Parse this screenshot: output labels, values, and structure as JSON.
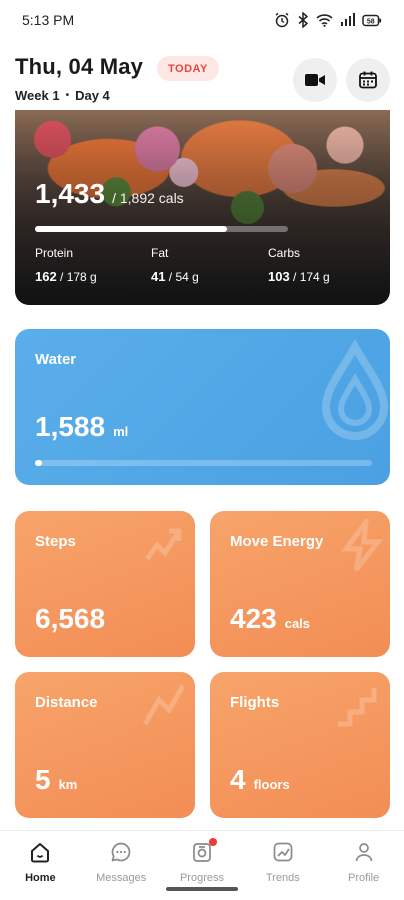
{
  "status_bar": {
    "time": "5:13 PM",
    "battery_level": "58"
  },
  "header": {
    "date": "Thu, 04 May",
    "badge": "TODAY",
    "week": "Week 1",
    "day": "Day 4",
    "icons": [
      "video-camera-icon",
      "calendar-icon"
    ]
  },
  "calories": {
    "consumed": "1,433",
    "target": "/ 1,892 cals",
    "progress": 0.757,
    "macros": [
      {
        "name": "Protein",
        "value": "162",
        "target": " / 178 g"
      },
      {
        "name": "Fat",
        "value": "41",
        "target": " / 54 g"
      },
      {
        "name": "Carbs",
        "value": "103",
        "target": " / 174 g"
      }
    ]
  },
  "water": {
    "label": "Water",
    "value": "1,588",
    "unit": "ml",
    "progress": 0.02
  },
  "tiles": {
    "steps": {
      "label": "Steps",
      "value": "6,568",
      "unit": ""
    },
    "move_energy": {
      "label": "Move Energy",
      "value": "423",
      "unit": "cals"
    },
    "distance": {
      "label": "Distance",
      "value": "5",
      "unit": "km"
    },
    "flights": {
      "label": "Flights",
      "value": "4",
      "unit": "floors"
    }
  },
  "nav": {
    "items": [
      {
        "label": "Home",
        "icon": "home-icon",
        "active": true
      },
      {
        "label": "Messages",
        "icon": "chat-icon",
        "active": false
      },
      {
        "label": "Progress",
        "icon": "progress-camera-icon",
        "active": false,
        "notification": true
      },
      {
        "label": "Trends",
        "icon": "trends-icon",
        "active": false
      },
      {
        "label": "Profile",
        "icon": "profile-icon",
        "active": false
      }
    ]
  },
  "colors": {
    "today_badge_bg": "#fde7e5",
    "today_badge_text": "#e24a3a",
    "water_card": "#4aa0e2",
    "activity_tiles": "#f28d55",
    "notification_dot": "#ec3b32"
  }
}
